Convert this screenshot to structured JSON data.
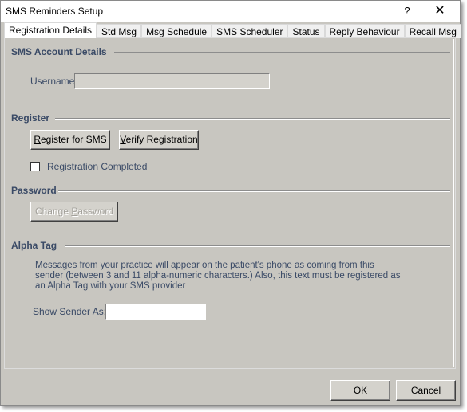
{
  "window": {
    "title": "SMS Reminders Setup",
    "help_label": "?",
    "close_label": "✕"
  },
  "tabs": [
    {
      "label": "Registration Details",
      "active": true
    },
    {
      "label": "Std Msg",
      "active": false
    },
    {
      "label": "Msg Schedule",
      "active": false
    },
    {
      "label": "SMS Scheduler",
      "active": false
    },
    {
      "label": "Status",
      "active": false
    },
    {
      "label": "Reply Behaviour",
      "active": false
    },
    {
      "label": "Recall Msg",
      "active": false
    }
  ],
  "account": {
    "section_title": "SMS Account Details",
    "username_label": "Username:",
    "username_value": ""
  },
  "register": {
    "section_title": "Register",
    "register_button": {
      "mnemonic": "R",
      "rest": "egister for SMS"
    },
    "verify_button": {
      "mnemonic": "V",
      "rest": "erify Registration"
    },
    "completed_label": "Registration Completed",
    "completed_checked": false
  },
  "password": {
    "section_title": "Password",
    "change_button": {
      "before": "Change ",
      "mnemonic": "P",
      "rest": "assword"
    },
    "change_enabled": false
  },
  "alpha_tag": {
    "section_title": "Alpha Tag",
    "description": "Messages from your practice will appear on the patient's phone as coming from this sender (between 3 and 11 alpha-numeric characters.) Also, this text must be registered as an Alpha Tag with your SMS provider",
    "sender_label": "Show Sender As:",
    "sender_value": ""
  },
  "footer": {
    "ok_label": "OK",
    "cancel_label": "Cancel"
  }
}
